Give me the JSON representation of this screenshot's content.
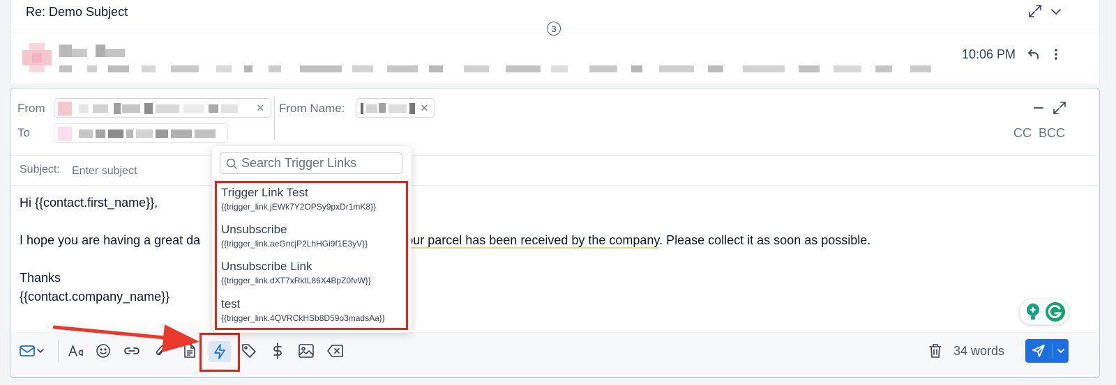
{
  "thread": {
    "subject": "Re: Demo Subject",
    "message_count": "3",
    "message_time": "10:06 PM"
  },
  "compose": {
    "from_label": "From",
    "from_name_label": "From Name:",
    "to_label": "To",
    "cc_label": "CC",
    "bcc_label": "BCC",
    "subject_label": "Subject:",
    "subject_value": "",
    "subject_placeholder": "Enter subject",
    "body": {
      "greeting": "Hi {{contact.first_name}},",
      "line1_start": "I hope you are having a great da",
      "line1_underlined": "your parcel has been received by the company",
      "line1_end": ". Please collect it as soon as possible.",
      "thanks": "Thanks",
      "signature": "{{contact.company_name}}"
    },
    "word_count": "34 words"
  },
  "trigger_dropdown": {
    "search_placeholder": "Search Trigger Links",
    "search_value": "",
    "items": [
      {
        "name": "Trigger Link Test",
        "code": "{{trigger_link.jEWk7Y2OPSy9pxDr1mK8}}"
      },
      {
        "name": "Unsubscribe",
        "code": "{{trigger_link.aeGncjP2LhHGi9f1E3yV}}"
      },
      {
        "name": "Unsubscribe Link",
        "code": "{{trigger_link.dXT7xRktL86X4BpZ0fvW}}"
      },
      {
        "name": "test",
        "code": "{{trigger_link.4QVRCkHSb8D59o3madsAa}}"
      }
    ]
  },
  "colors": {
    "accent": "#1d6fe0",
    "highlight_red": "#e0261d",
    "border": "#b9c8db"
  },
  "icons": [
    "expand-icon",
    "chevron-down-icon",
    "reply-icon",
    "more-vertical-icon",
    "minimize-icon",
    "fullscreen-icon",
    "mail-icon",
    "text-format-icon",
    "emoji-icon",
    "link-icon",
    "attachment-icon",
    "template-icon",
    "trigger-link-icon",
    "tag-icon",
    "dollar-icon",
    "image-icon",
    "clear-format-icon",
    "trash-icon",
    "send-icon",
    "search-icon",
    "grammarly-icon"
  ]
}
